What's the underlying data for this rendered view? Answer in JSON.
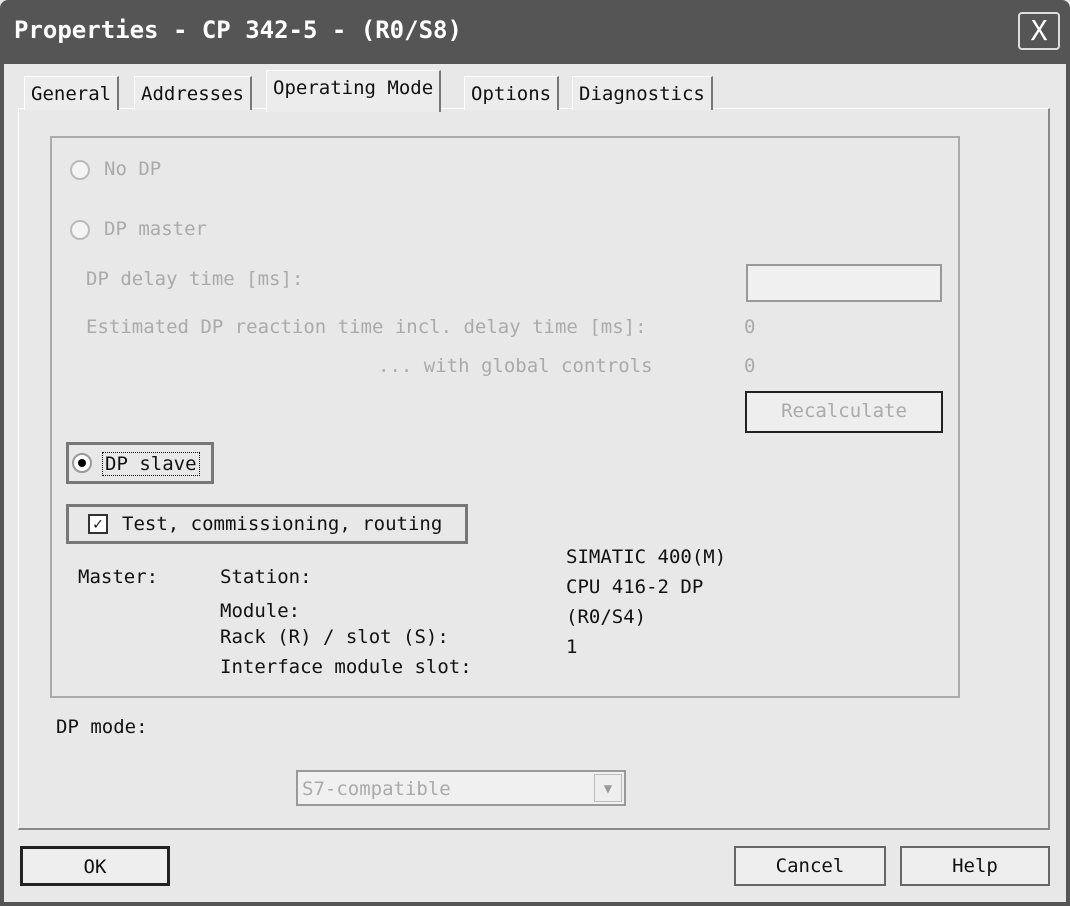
{
  "window": {
    "title": "Properties - CP 342-5 - (R0/S8)",
    "close": "X"
  },
  "tabs": [
    "General",
    "Addresses",
    "Operating Mode",
    "Options",
    "Diagnostics"
  ],
  "no_dp": "No DP",
  "dp_master": "DP master",
  "dp_delay_label": "DP delay time [ms]:",
  "dp_delay_value": "",
  "est_label": "Estimated DP reaction time incl. delay time [ms]:",
  "est_value": "0",
  "global_label": "... with global controls",
  "global_value": "0",
  "recalculate": "Recalculate",
  "dp_slave": "DP slave",
  "test_checkbox": "Test, commissioning, routing",
  "master": {
    "label": "Master:",
    "fields": [
      "Station:",
      "Module:",
      "Rack (R) / slot (S):",
      "Interface module slot:"
    ],
    "values": [
      "SIMATIC 400(M)",
      "CPU 416-2 DP",
      "(R0/S4)",
      "1"
    ]
  },
  "dp_mode_label": "DP mode:",
  "dp_mode_value": "S7-compatible",
  "buttons": {
    "ok": "OK",
    "cancel": "Cancel",
    "help": "Help"
  }
}
